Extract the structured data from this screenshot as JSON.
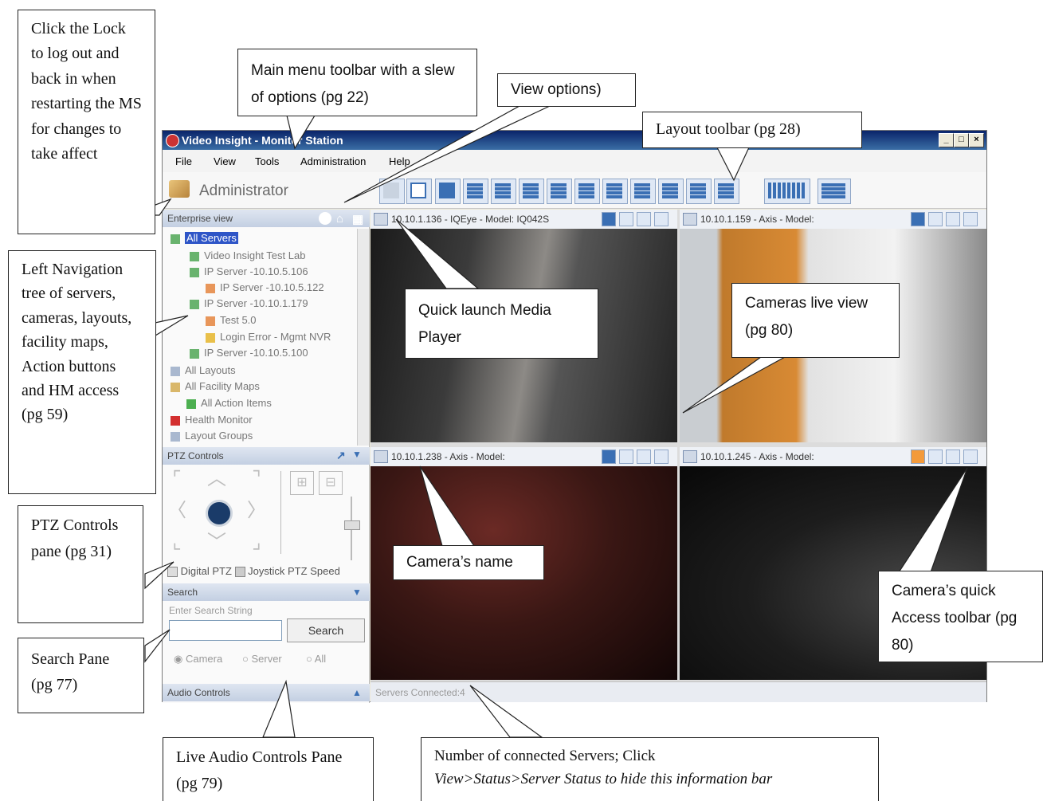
{
  "window": {
    "title": "Video Insight - Monitor Station",
    "controls": {
      "minimize": "_",
      "maximize": "□",
      "close": "×"
    }
  },
  "menu": {
    "items": [
      "File",
      "View",
      "Tools",
      "Administration",
      "Help"
    ]
  },
  "toolbar": {
    "user_label": "Administrator",
    "lock_icon": "lock-icon"
  },
  "left_panel": {
    "enterprise_header": "Enterprise view",
    "enterprise_icons": [
      "globe-icon",
      "home-icon",
      "grid-icon"
    ],
    "tree": [
      {
        "label": "All Servers",
        "selected": true
      },
      {
        "label": "Video Insight Test Lab"
      },
      {
        "label": "IP Server -10.10.5.106"
      },
      {
        "label": "IP Server -10.10.5.122"
      },
      {
        "label": "IP Server -10.10.1.179"
      },
      {
        "label": "Test 5.0"
      },
      {
        "label": "Login Error - Mgmt NVR"
      },
      {
        "label": "IP Server -10.10.5.100"
      },
      {
        "label": "All Layouts"
      },
      {
        "label": "All Facility Maps"
      },
      {
        "label": "All Action Items"
      },
      {
        "label": "Health Monitor"
      },
      {
        "label": "Layout Groups"
      }
    ],
    "ptz_header": "PTZ Controls",
    "digital_ptz": "Digital PTZ",
    "joystick_ptz": "Joystick PTZ",
    "speed": "Speed",
    "search_header": "Search",
    "search_placeholder": "Enter Search String",
    "search_button": "Search",
    "radios": [
      "Camera",
      "Server",
      "All"
    ],
    "audio_header": "Audio Controls"
  },
  "tiles": [
    {
      "name": "10.10.1.136 - IQEye - Model: IQ042S"
    },
    {
      "name": "10.10.1.159 - Axis - Model:"
    },
    {
      "name": "10.10.1.238 - Axis - Model:"
    },
    {
      "name": "10.10.1.245 - Axis - Model:"
    }
  ],
  "status": {
    "text": "Servers Connected:4"
  },
  "callouts": {
    "lock": "Click the Lock to log out and back in when restarting the MS for changes to take affect",
    "menu": "Main menu toolbar with a slew of options (pg 22)",
    "view_options": "View options)",
    "layout": "Layout toolbar (pg 28)",
    "left_nav": "Left Navigation tree of servers, cameras, layouts, facility maps, Action buttons and HM access (pg 59)",
    "quick_launch": "Quick launch Media Player",
    "live_view": "Cameras live view (pg 80)",
    "ptz": "PTZ Controls pane (pg 31)",
    "camera_name": "Camera’s name",
    "quick_access": "Camera’s quick Access toolbar (pg 80)",
    "search_pane": "Search Pane (pg 77)",
    "audio": "Live Audio Controls Pane (pg 79)",
    "servers_line1": "Number of connected Servers; Click",
    "servers_line2": "View>Status>Server Status to hide this information bar"
  }
}
